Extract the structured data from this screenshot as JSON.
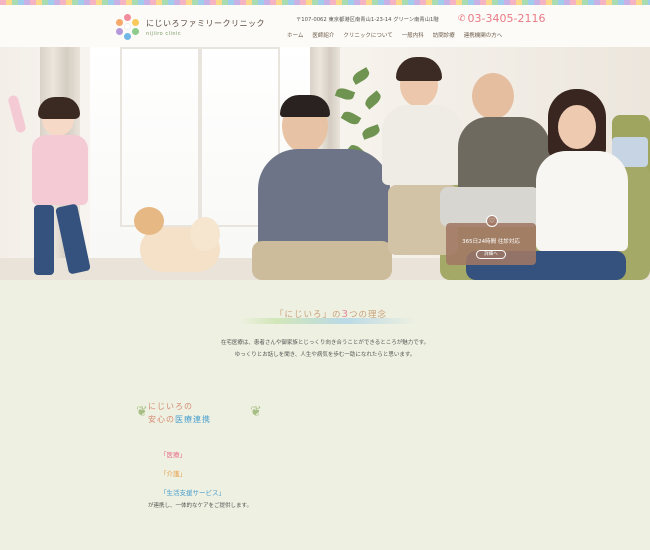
{
  "header": {
    "logo_ja": "にじいろファミリークリニック",
    "logo_en": "nijiiro clinic",
    "address": "〒107-0062 東京都港区南青山1-23-14 グリーン南青山1階",
    "phone": "03-3405-2116",
    "nav": [
      "ホーム",
      "医師紹介",
      "クリニックについて",
      "一般内科",
      "訪問診療",
      "連携機関の方へ"
    ]
  },
  "hero": {
    "badge_text": "365日24時間 往診対応",
    "badge_button": "詳細へ"
  },
  "philosophy": {
    "title_open": "「にじいろ」の",
    "title_num": "3",
    "title_close": "つの理念",
    "intro_line1": "在宅医療は、患者さんや御家族とじっくり向き合うことができるところが魅力です。",
    "intro_line2": "ゆっくりとお話しを聞き、人生や病気を歩む一助になれたらと思います。"
  },
  "cooperation": {
    "line1": "にじいろの",
    "line2_a": "安心",
    "line2_b": "の",
    "line2_c": "医療連携",
    "items": [
      "「医療」",
      "「介護」",
      "「生活支援サービス」"
    ],
    "footer": "が連携し、一体的なケアをご提供します。"
  },
  "colors": {
    "accent_pink": "#e87a86",
    "accent_blue": "#4b9fd0",
    "background_green": "#eef0e1"
  }
}
